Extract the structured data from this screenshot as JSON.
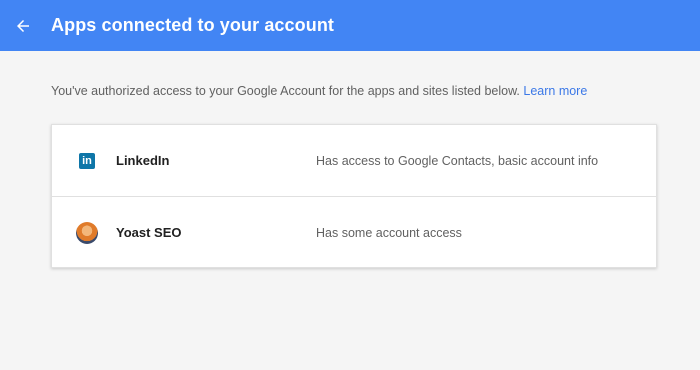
{
  "header": {
    "title": "Apps connected to your account",
    "accent_color": "#4285f4"
  },
  "intro": {
    "text": "You've authorized access to your Google Account for the apps and sites listed below.",
    "link_label": "Learn more"
  },
  "apps": [
    {
      "name": "LinkedIn",
      "icon": "linkedin-icon",
      "access": "Has access to Google Contacts, basic account info"
    },
    {
      "name": "Yoast SEO",
      "icon": "yoast-avatar-icon",
      "access": "Has some account access"
    }
  ]
}
